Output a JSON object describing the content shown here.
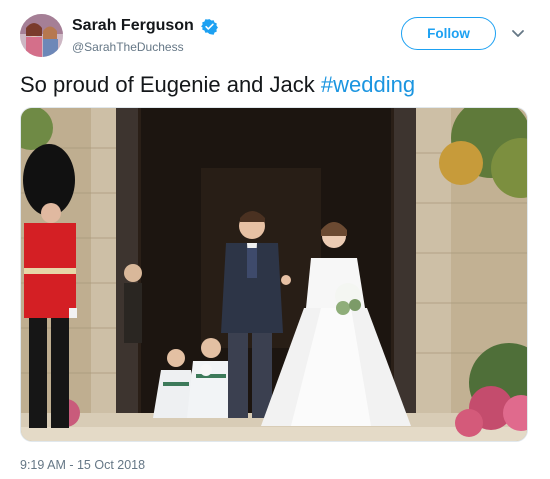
{
  "user": {
    "display_name": "Sarah Ferguson",
    "handle": "@SarahTheDuchess",
    "verified": true
  },
  "actions": {
    "follow_label": "Follow",
    "more_icon": "chevron-down-icon"
  },
  "tweet": {
    "text": "So proud of Eugenie and Jack ",
    "hashtag": "#wedding",
    "timestamp": "9:19 AM - 15 Oct 2018"
  },
  "colors": {
    "accent": "#1da1f2",
    "hashtag": "#1b95e0",
    "secondary_text": "#657786"
  }
}
